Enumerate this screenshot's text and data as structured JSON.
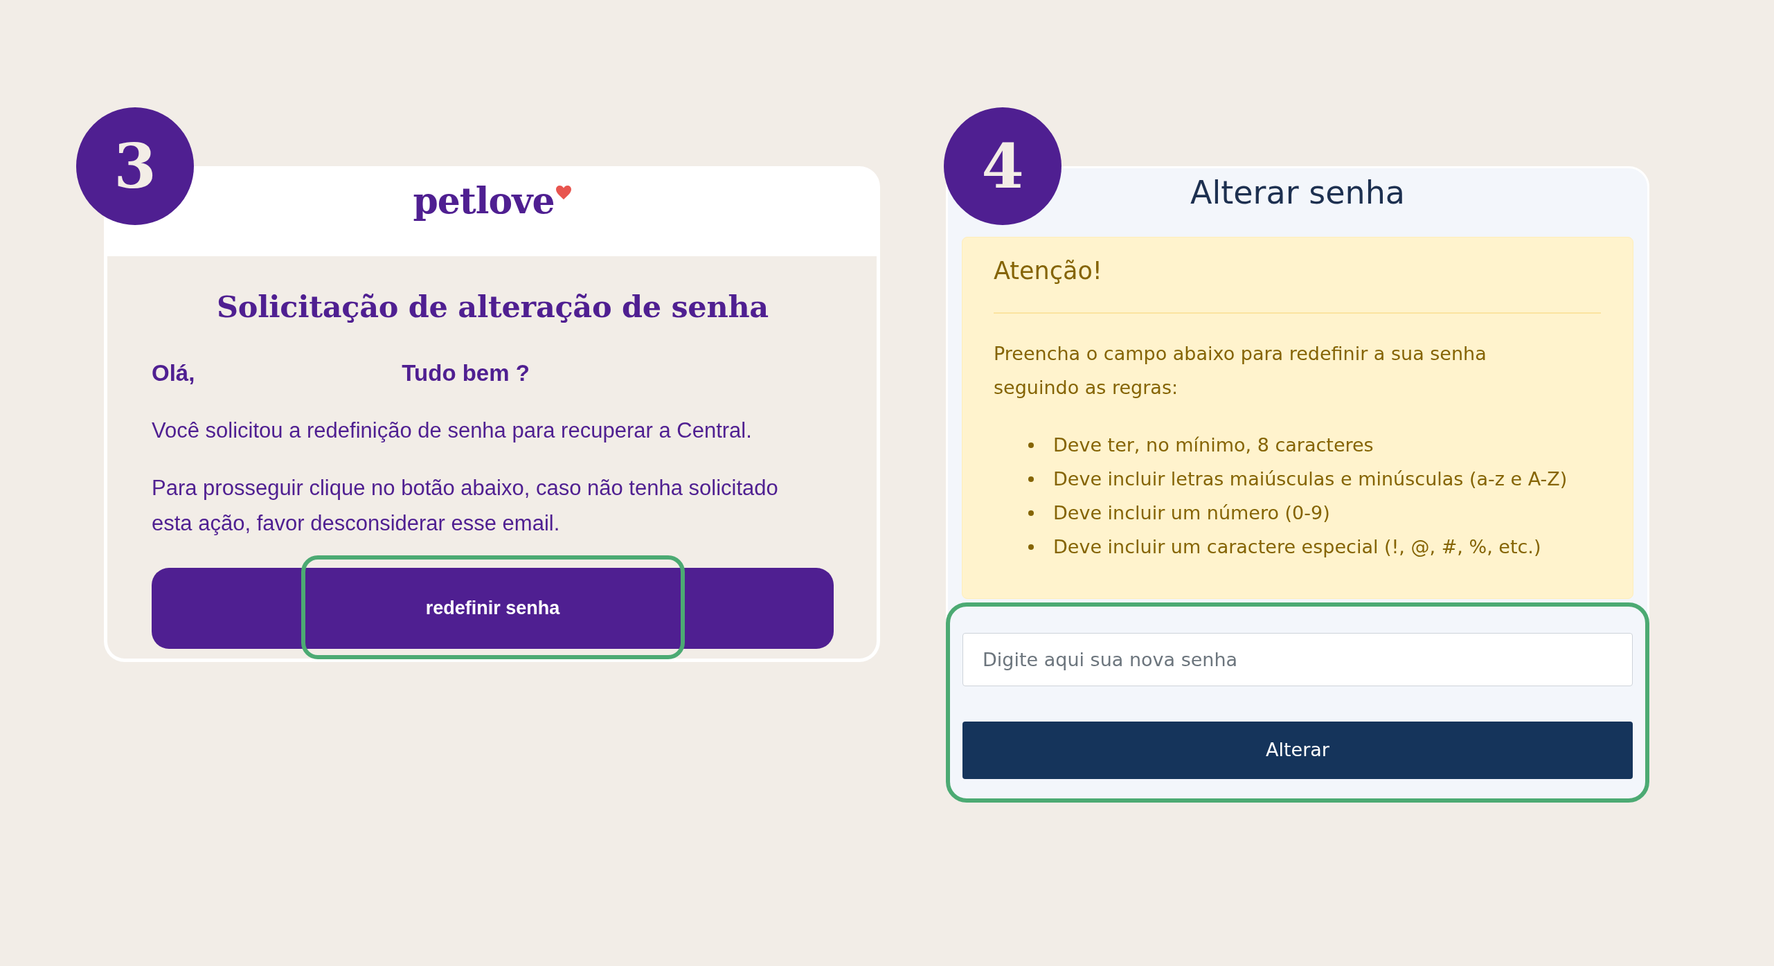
{
  "steps": [
    {
      "kind": "email",
      "number": "3",
      "logo": "petlove",
      "title": "Solicitação de alteração de senha",
      "greeting": [
        "Olá,",
        "Tudo bem ?"
      ],
      "paragraphs": [
        "Você solicitou a redefinição de senha para recuperar a Central.",
        "Para prosseguir clique no botão abaixo, caso não tenha solicitado esta ação, favor desconsiderar esse email."
      ],
      "button": {
        "label": "redefinir senha",
        "highlighted": true
      }
    },
    {
      "kind": "form",
      "number": "4",
      "title": "Alterar senha",
      "alert": {
        "heading": "Atenção!",
        "text": "Preencha o campo abaixo para redefinir a sua senha seguindo as regras:",
        "rules": [
          "Deve ter, no mínimo, 8 caracteres",
          "Deve incluir letras maiúsculas e minúsculas (a-z e A-Z)",
          "Deve incluir um número (0-9)",
          "Deve incluir um caractere especial (!, @, #, %, etc.)"
        ]
      },
      "form": {
        "highlighted": true,
        "password_field": {
          "placeholder": "Digite aqui sua nova senha"
        },
        "button": {
          "label": "Alterar"
        }
      }
    }
  ]
}
